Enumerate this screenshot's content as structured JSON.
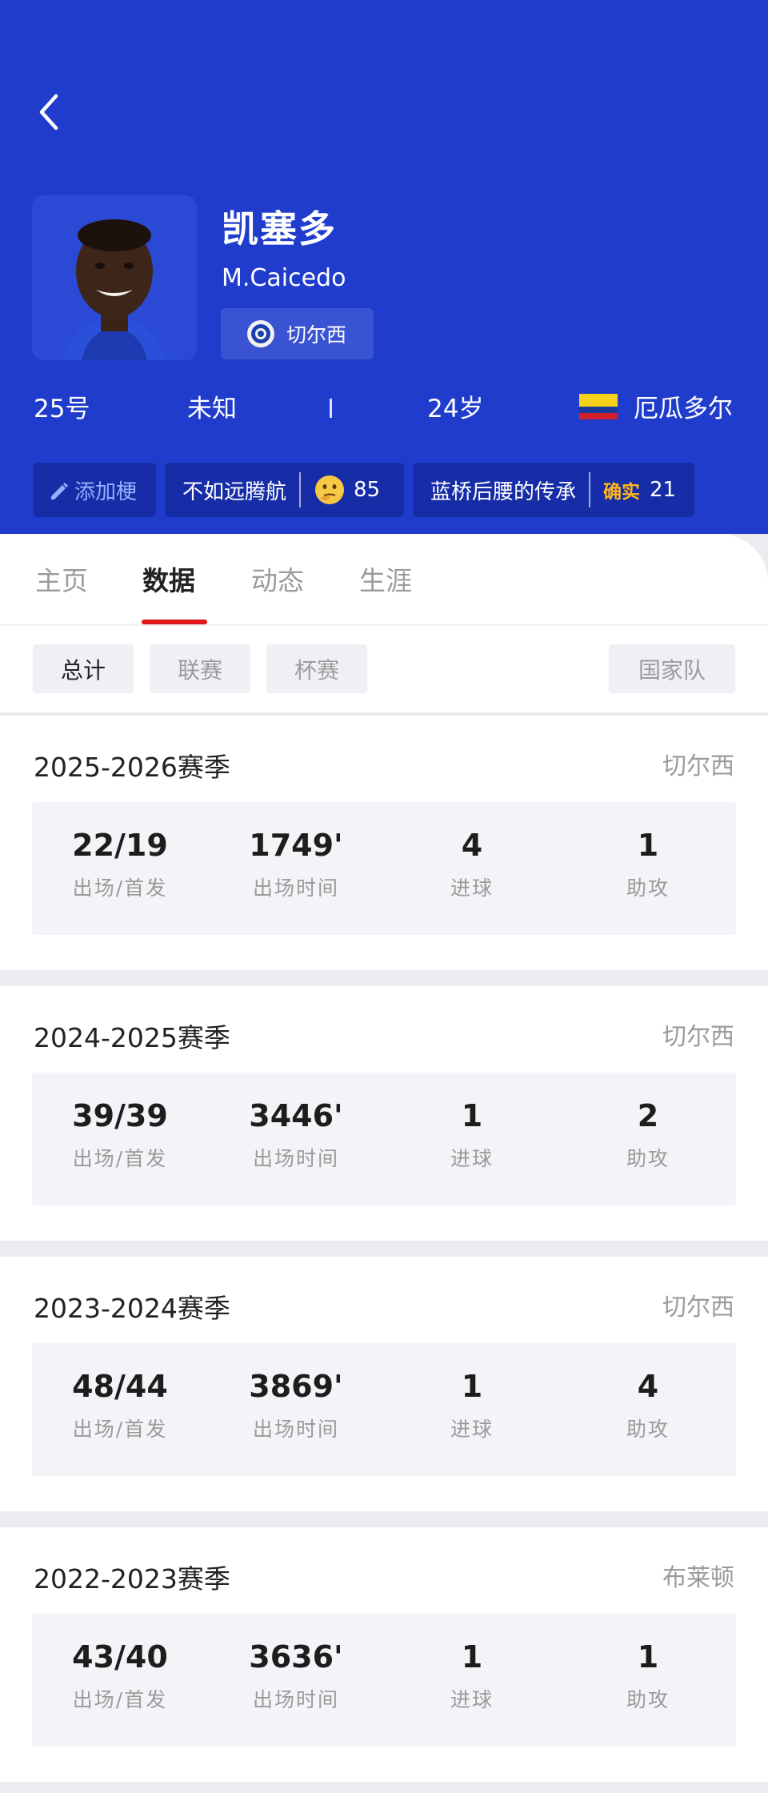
{
  "player": {
    "name": "凯塞多",
    "english_name": "M.Caicedo",
    "club": "切尔西",
    "number": "25号",
    "position": "未知",
    "age": "24岁",
    "nationality": "厄瓜多尔"
  },
  "tags": {
    "add_label": "添加梗",
    "tag1": {
      "text": "不如远腾航",
      "count": "85"
    },
    "tag2": {
      "text": "蓝桥后腰的传承",
      "badge": "确实",
      "count": "21"
    }
  },
  "tabs": [
    "主页",
    "数据",
    "动态",
    "生涯"
  ],
  "filters": [
    "总计",
    "联赛",
    "杯赛",
    "国家队"
  ],
  "stat_labels": [
    "出场/首发",
    "出场时间",
    "进球",
    "助攻"
  ],
  "seasons": [
    {
      "season": "2025-2026赛季",
      "team": "切尔西",
      "apps": "22/19",
      "minutes": "1749'",
      "goals": "4",
      "assists": "1"
    },
    {
      "season": "2024-2025赛季",
      "team": "切尔西",
      "apps": "39/39",
      "minutes": "3446'",
      "goals": "1",
      "assists": "2"
    },
    {
      "season": "2023-2024赛季",
      "team": "切尔西",
      "apps": "48/44",
      "minutes": "3869'",
      "goals": "1",
      "assists": "4"
    },
    {
      "season": "2022-2023赛季",
      "team": "布莱顿",
      "apps": "43/40",
      "minutes": "3636'",
      "goals": "1",
      "assists": "1"
    }
  ],
  "colors": {
    "header_bg": "#1f3ccc",
    "accent": "#e0141b"
  }
}
